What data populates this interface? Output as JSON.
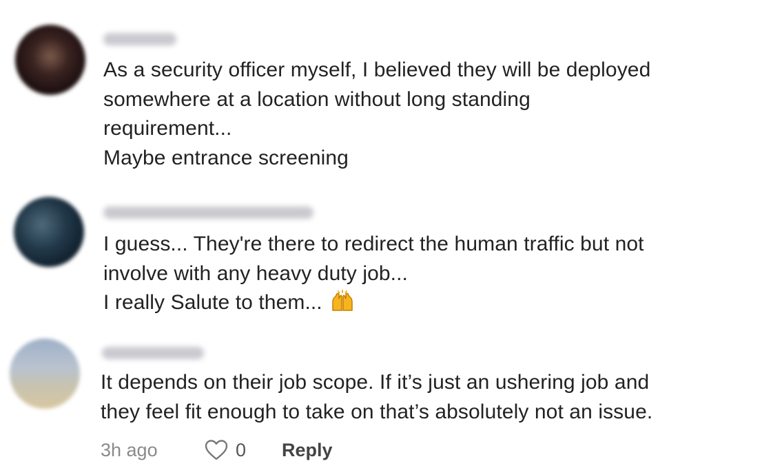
{
  "comments": [
    {
      "lines": [
        "As a security officer myself, I believed they will be deployed",
        "somewhere at a location without long standing",
        "requirement...",
        "Maybe entrance screening"
      ]
    },
    {
      "lines": [
        "I guess... They're there to redirect the human traffic but not",
        "involve with any heavy duty job...",
        "I really Salute to them..."
      ],
      "emoji": "raising-hands-emoji"
    },
    {
      "lines": [
        "It depends on their job scope. If it’s just an ushering job and",
        "they feel fit enough to take on that’s absolutely not an issue."
      ],
      "time": "3h ago",
      "like_count": "0",
      "reply_label": "Reply"
    }
  ],
  "icons": {
    "like": "heart-outline-icon"
  },
  "colors": {
    "text": "#222222",
    "meta": "#8a8a8a",
    "reply": "#444444"
  }
}
